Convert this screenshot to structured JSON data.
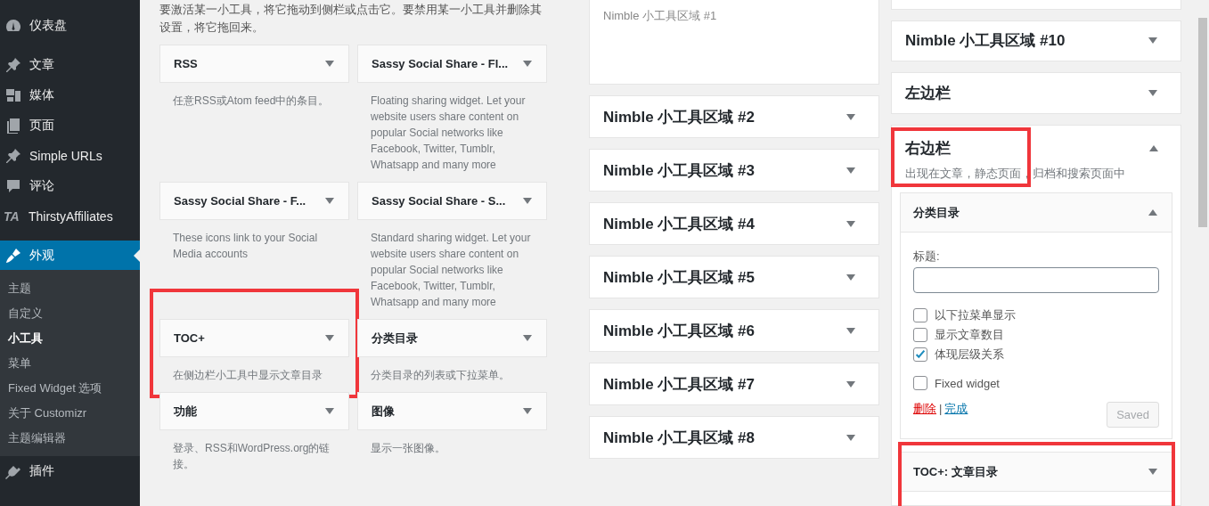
{
  "sidebar": {
    "menu_groups": [
      [
        {
          "label": "仪表盘",
          "kind": "gauge",
          "selected": false
        }
      ],
      [
        {
          "label": "文章",
          "kind": "pin",
          "selected": false
        },
        {
          "label": "媒体",
          "kind": "media",
          "selected": false
        },
        {
          "label": "页面",
          "kind": "pages",
          "selected": false
        },
        {
          "label": "Simple URLs",
          "kind": "pin",
          "selected": false
        },
        {
          "label": "评论",
          "kind": "comment",
          "selected": false
        },
        {
          "label": "ThirstyAffiliates",
          "kind": "text",
          "icon_text": "TA",
          "selected": false
        }
      ],
      [
        {
          "label": "外观",
          "kind": "brush",
          "selected": true,
          "children": [
            {
              "label": "主题",
              "selected": false
            },
            {
              "label": "自定义",
              "selected": false
            },
            {
              "label": "小工具",
              "selected": true
            },
            {
              "label": "菜单",
              "selected": false
            },
            {
              "label": "Fixed Widget 选项",
              "selected": false
            },
            {
              "label": "关于 Customizr",
              "selected": false
            },
            {
              "label": "主题编辑器",
              "selected": false
            }
          ]
        },
        {
          "label": "插件",
          "kind": "plug",
          "selected": false
        }
      ]
    ]
  },
  "available_widgets": {
    "intro": "要激活某一小工具，将它拖动到侧栏或点击它。要禁用某一小工具并删除其设置，将它拖回来。",
    "widgets": [
      {
        "title": "RSS",
        "description": "任意RSS或Atom feed中的条目。",
        "highlighted": false
      },
      {
        "title": "Sassy Social Share - Fl...",
        "description": "Floating sharing widget. Let your website users share content on popular Social networks like Facebook, Twitter, Tumblr, Whatsapp and many more",
        "highlighted": false
      },
      {
        "title": "Sassy Social Share - F...",
        "description": "These icons link to your Social Media accounts",
        "highlighted": false
      },
      {
        "title": "Sassy Social Share - S...",
        "description": "Standard sharing widget. Let your website users share content on popular Social networks like Facebook, Twitter, Tumblr, Whatsapp and many more",
        "highlighted": false
      },
      {
        "title": "TOC+",
        "description": "在侧边栏小工具中显示文章目录",
        "highlighted": true
      },
      {
        "title": "分类目录",
        "description": "分类目录的列表或下拉菜单。",
        "highlighted": false
      },
      {
        "title": "功能",
        "description": "登录、RSS和WordPress.org的链接。",
        "highlighted": false
      },
      {
        "title": "图像",
        "description": "显示一张图像。",
        "highlighted": false
      }
    ]
  },
  "area_columns": [
    [
      {
        "kind": "empty",
        "title": "Nimble 小工具区域 #1"
      },
      {
        "kind": "collapsed",
        "title": "Nimble 小工具区域 #2"
      },
      {
        "kind": "collapsed",
        "title": "Nimble 小工具区域 #3"
      },
      {
        "kind": "collapsed",
        "title": "Nimble 小工具区域 #4"
      },
      {
        "kind": "collapsed",
        "title": "Nimble 小工具区域 #5"
      },
      {
        "kind": "collapsed",
        "title": "Nimble 小工具区域 #6"
      },
      {
        "kind": "collapsed",
        "title": "Nimble 小工具区域 #7"
      },
      {
        "kind": "collapsed",
        "title": "Nimble 小工具区域 #8"
      }
    ],
    [
      {
        "kind": "cut"
      },
      {
        "kind": "collapsed",
        "title": "Nimble 小工具区域 #10"
      },
      {
        "kind": "collapsed",
        "title": "左边栏"
      },
      {
        "kind": "expanded",
        "title": "右边栏",
        "description": "出现在文章，静态页面，归档和搜索页面中",
        "highlighted": true,
        "widgets": [
          {
            "title": "分类目录",
            "expanded": true,
            "highlighted": false,
            "form": {
              "title_label": "标题:",
              "options": [
                {
                  "label": "以下拉菜单显示",
                  "checked": false
                },
                {
                  "label": "显示文章数目",
                  "checked": false
                },
                {
                  "label": "体现层级关系",
                  "checked": true
                }
              ],
              "extra_options": [
                {
                  "label": "Fixed widget",
                  "checked": false
                }
              ],
              "delete_link": "删除",
              "link_separator": "|",
              "done_link": "完成",
              "save_button": "Saved",
              "save_disabled": true
            }
          },
          {
            "title": "TOC+: 文章目录",
            "expanded": false,
            "highlighted": true
          }
        ]
      }
    ]
  ]
}
